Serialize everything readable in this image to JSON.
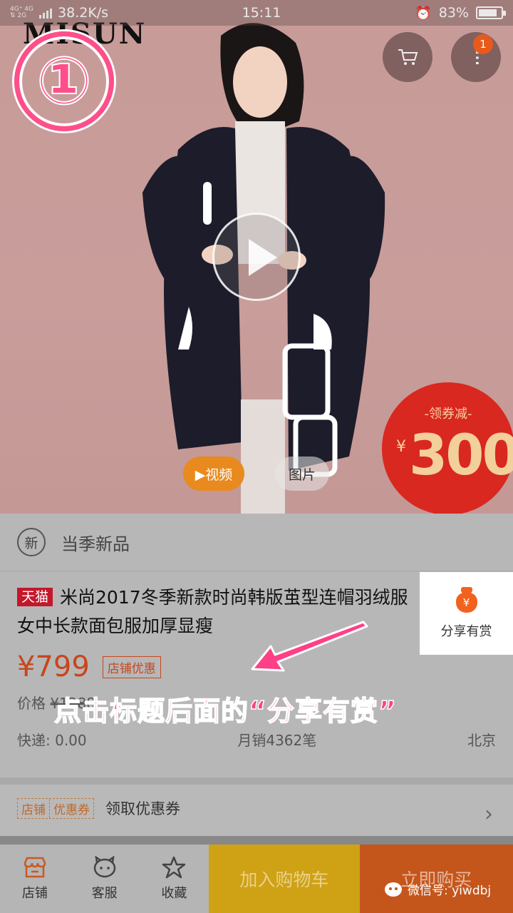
{
  "status_bar": {
    "net_top": "4G⁺ 4G",
    "net_bottom": "⇅ 2G",
    "speed": "38.2K/s",
    "time": "15:11",
    "battery_percent": "83%",
    "battery_level": 0.83
  },
  "hero": {
    "brand": "MISUN",
    "step_number": "①",
    "cart_icon": "cart-icon",
    "badge_count": "1",
    "video_label": "▶视频",
    "photo_label": "图片",
    "coupon_seal": {
      "title": "-领券减-",
      "currency": "¥",
      "amount": "300"
    }
  },
  "product": {
    "new_badge": "新",
    "new_label": "当季新品",
    "platform_tag": "天猫",
    "title": "米尚2017冬季新款时尚韩版茧型连帽羽绒服女中长款面包服加厚显瘦",
    "share": {
      "icon": "money-bag-icon",
      "label": "分享有赏"
    },
    "price": "¥799",
    "store_discount": "店铺优惠",
    "original_price_label": "价格",
    "original_price": "¥1288",
    "shipping": "快递: 0.00",
    "monthly_sales": "月销4362笔",
    "location": "北京"
  },
  "annotation": "点击标题后面的“分享有赏”",
  "coupon_row": {
    "tag_left": "店铺",
    "tag_right": "优惠券",
    "text": "领取优惠券",
    "chevron": "›"
  },
  "bottom_bar": {
    "store": "店铺",
    "service": "客服",
    "favorite": "收藏",
    "add_to_cart": "加入购物车",
    "buy_now": "立即购买"
  },
  "watermark": "微信号: yiwdbj",
  "colors": {
    "price": "#c8461d",
    "tmall": "#c4172a",
    "annotation": "#ff3f86",
    "add_to_cart": "#cfa114",
    "buy_now": "#c4561c"
  }
}
